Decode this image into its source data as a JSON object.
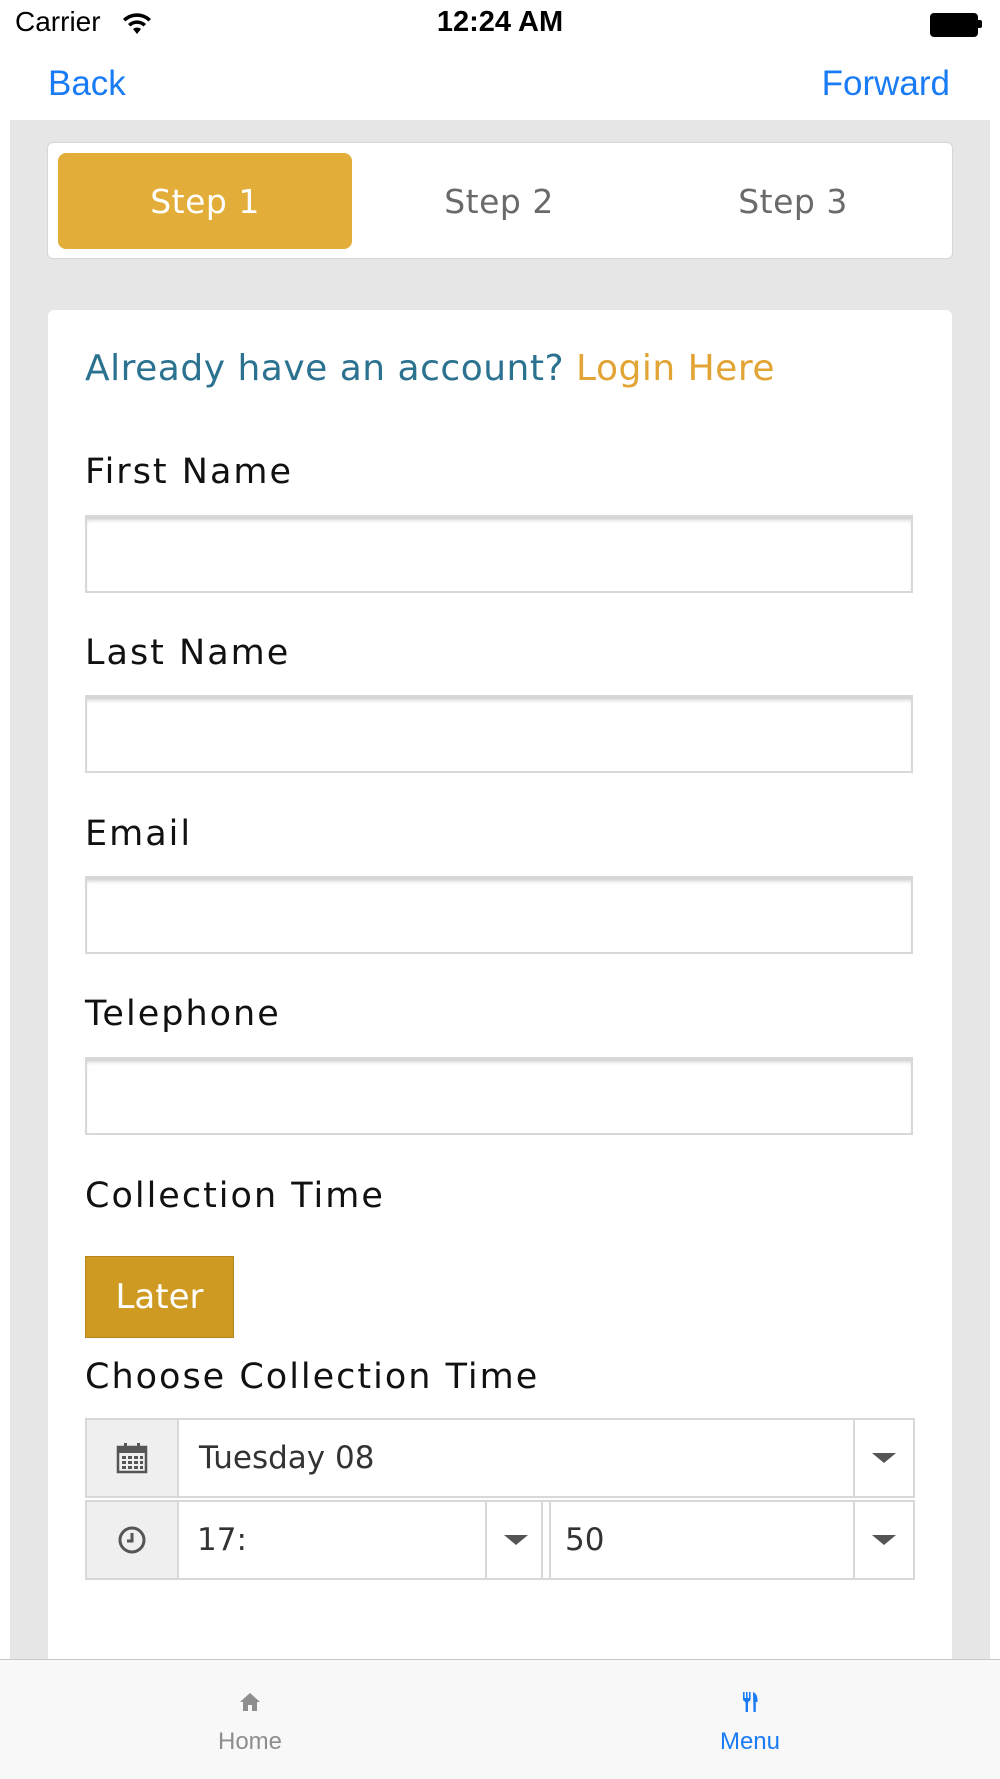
{
  "status_bar": {
    "carrier": "Carrier",
    "time": "12:24 AM"
  },
  "nav": {
    "back_label": "Back",
    "forward_label": "Forward"
  },
  "steps": [
    {
      "label": "Step 1",
      "active": true
    },
    {
      "label": "Step 2",
      "active": false
    },
    {
      "label": "Step 3",
      "active": false
    }
  ],
  "form": {
    "login_prompt": "Already have an account?",
    "login_link": "Login Here",
    "first_name_label": "First Name",
    "first_name_value": "",
    "last_name_label": "Last Name",
    "last_name_value": "",
    "email_label": "Email",
    "email_value": "",
    "telephone_label": "Telephone",
    "telephone_value": "",
    "collection_time_label": "Collection Time",
    "later_button": "Later",
    "choose_collection_time_label": "Choose Collection Time",
    "date_value": "Tuesday 08",
    "hour_value": "17:",
    "minute_value": "50"
  },
  "tabbar": {
    "home_label": "Home",
    "menu_label": "Menu",
    "active": "Menu"
  },
  "colors": {
    "accent_gold": "#e2ad38",
    "later_gold": "#cf9a22",
    "ios_blue": "#1a7cf4",
    "prompt_teal": "#2b7290"
  },
  "icons": [
    "wifi-icon",
    "battery-icon",
    "calendar-icon",
    "clock-icon",
    "chevron-down-icon",
    "home-icon",
    "fork-knife-icon"
  ]
}
